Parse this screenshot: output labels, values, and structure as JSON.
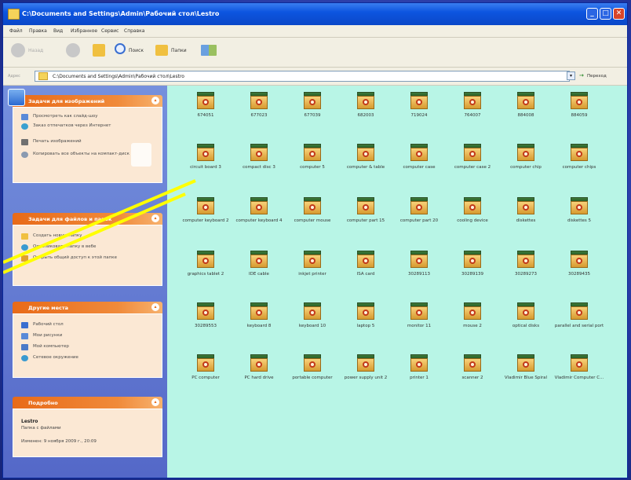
{
  "window": {
    "title": "C:\\Documents and Settings\\Admin\\Рабочий стол\\Lestro",
    "min_icon": "minimize-icon",
    "max_icon": "maximize-icon",
    "close_icon": "close-icon"
  },
  "menu": [
    "Файл",
    "Правка",
    "Вид",
    "Избранное",
    "Сервис",
    "Справка"
  ],
  "toolbar": {
    "back": "Назад",
    "search": "Поиск",
    "folders": "Папки"
  },
  "address": {
    "label": "Адрес",
    "path": "C:\\Documents and Settings\\Admin\\Рабочий стол\\Lestro",
    "go": "Переход"
  },
  "sidebar": {
    "image_tasks": {
      "title": "Задачи для изображений",
      "items": [
        "Просмотреть как слайд-шоу",
        "Заказ отпечатков через Интернет",
        "Печать изображений",
        "Копировать все объекты на компакт-диск"
      ]
    },
    "file_tasks": {
      "title": "Задачи для файлов и папок",
      "items": [
        "Создать новую папку",
        "Опубликовать папку в вебе",
        "Открыть общий доступ к этой папке"
      ]
    },
    "other_places": {
      "title": "Другие места",
      "items": [
        "Рабочий стол",
        "Мои рисунки",
        "Мой компьютер",
        "Сетевое окружение"
      ]
    },
    "details": {
      "title": "Подробно",
      "name": "Lestro",
      "type": "Папка с файлами",
      "modified": "Изменен: 9 ноября 2009 г., 20:09"
    }
  },
  "files": [
    "674051",
    "677023",
    "677039",
    "682003",
    "719024",
    "764007",
    "884008",
    "884059",
    "circuit board 3",
    "compact disc 3",
    "computer 5",
    "computer & table",
    "computer case",
    "computer case 2",
    "computer chip",
    "computer chips",
    "computer keyboard 2",
    "computer keyboard 4",
    "computer mouse",
    "computer part 15",
    "computer part 20",
    "cooling device",
    "diskettes",
    "diskettes 5",
    "graphics tablet 2",
    "IDE cable",
    "inkjet printer",
    "ISA card",
    "30289113",
    "30289139",
    "30289273",
    "30289435",
    "30289553",
    "keyboard 8",
    "keyboard 10",
    "laptop 5",
    "monitor 11",
    "mouse 2",
    "optical disks",
    "parallel and serial port",
    "PC computer",
    "PC hard drive",
    "portable computer",
    "power supply unit 2",
    "printer 1",
    "scanner 2",
    "Vladimir Blue Spiral",
    "Vladimir Computer C..."
  ],
  "colors": {
    "content_bg": "#b8f5e6",
    "pointer": "#ffff00",
    "titlebar": "#0d55e0",
    "panel_header": "#e86a18"
  }
}
